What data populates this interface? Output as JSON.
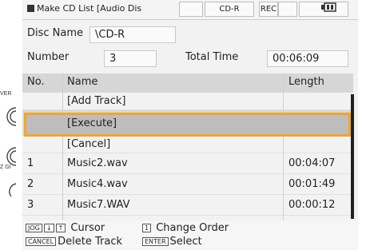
{
  "device": {
    "edge_labels": [
      "VER",
      "Z GI"
    ]
  },
  "status_bar": {
    "title": "Make CD List [Audio Dis",
    "media": "CD-R",
    "rec": "REC"
  },
  "disc": {
    "label": "Disc Name",
    "value": "\\CD-R"
  },
  "number": {
    "label": "Number",
    "value": "3",
    "total_label": "Total Time",
    "total_value": "00:06:09"
  },
  "table": {
    "headers": {
      "no": "No.",
      "name": "Name",
      "length": "Length"
    },
    "rows": [
      {
        "no": "",
        "name": "[Add Track]",
        "length": ""
      },
      {
        "no": "",
        "name": "[Execute]",
        "length": ""
      },
      {
        "no": "",
        "name": "[Cancel]",
        "length": ""
      },
      {
        "no": "1",
        "name": "Music2.wav",
        "length": "00:04:07"
      },
      {
        "no": "2",
        "name": "Music4.wav",
        "length": "00:01:49"
      },
      {
        "no": "3",
        "name": "Music7.WAV",
        "length": "00:00:12"
      }
    ],
    "selected_index": 1
  },
  "footer": {
    "jog_key": "JOG",
    "cursor_label": "Cursor",
    "change_key": "1",
    "change_label": "Change Order",
    "cancel_key": "CANCEL",
    "delete_label": "Delete Track",
    "enter_key": "ENTER",
    "select_label": "Select"
  },
  "colors": {
    "highlight": "#f5a623",
    "header_bg": "#d6d6d6"
  }
}
